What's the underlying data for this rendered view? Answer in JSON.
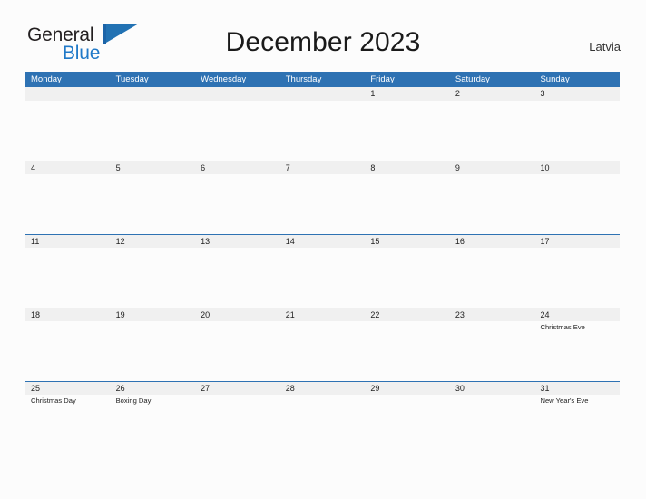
{
  "brand": {
    "name_line1": "General",
    "name_line2": "Blue",
    "flag_icon": "flag-triangle-icon"
  },
  "header": {
    "title": "December 2023",
    "country": "Latvia"
  },
  "colors": {
    "header_blue": "#2e72b3",
    "band_gray": "#f0f0f0",
    "brand_blue": "#2079c8",
    "page_background": "#fcfcfc",
    "text": "#222222"
  },
  "calendar": {
    "weekday_headers": [
      "Monday",
      "Tuesday",
      "Wednesday",
      "Thursday",
      "Friday",
      "Saturday",
      "Sunday"
    ],
    "weeks": [
      {
        "ruled": false,
        "days": [
          {
            "date": "",
            "event": ""
          },
          {
            "date": "",
            "event": ""
          },
          {
            "date": "",
            "event": ""
          },
          {
            "date": "",
            "event": ""
          },
          {
            "date": "1",
            "event": ""
          },
          {
            "date": "2",
            "event": ""
          },
          {
            "date": "3",
            "event": ""
          }
        ]
      },
      {
        "ruled": true,
        "days": [
          {
            "date": "4",
            "event": ""
          },
          {
            "date": "5",
            "event": ""
          },
          {
            "date": "6",
            "event": ""
          },
          {
            "date": "7",
            "event": ""
          },
          {
            "date": "8",
            "event": ""
          },
          {
            "date": "9",
            "event": ""
          },
          {
            "date": "10",
            "event": ""
          }
        ]
      },
      {
        "ruled": true,
        "days": [
          {
            "date": "11",
            "event": ""
          },
          {
            "date": "12",
            "event": ""
          },
          {
            "date": "13",
            "event": ""
          },
          {
            "date": "14",
            "event": ""
          },
          {
            "date": "15",
            "event": ""
          },
          {
            "date": "16",
            "event": ""
          },
          {
            "date": "17",
            "event": ""
          }
        ]
      },
      {
        "ruled": true,
        "days": [
          {
            "date": "18",
            "event": ""
          },
          {
            "date": "19",
            "event": ""
          },
          {
            "date": "20",
            "event": ""
          },
          {
            "date": "21",
            "event": ""
          },
          {
            "date": "22",
            "event": ""
          },
          {
            "date": "23",
            "event": ""
          },
          {
            "date": "24",
            "event": "Christmas Eve"
          }
        ]
      },
      {
        "ruled": true,
        "days": [
          {
            "date": "25",
            "event": "Christmas Day"
          },
          {
            "date": "26",
            "event": "Boxing Day"
          },
          {
            "date": "27",
            "event": ""
          },
          {
            "date": "28",
            "event": ""
          },
          {
            "date": "29",
            "event": ""
          },
          {
            "date": "30",
            "event": ""
          },
          {
            "date": "31",
            "event": "New Year's Eve"
          }
        ]
      }
    ]
  }
}
